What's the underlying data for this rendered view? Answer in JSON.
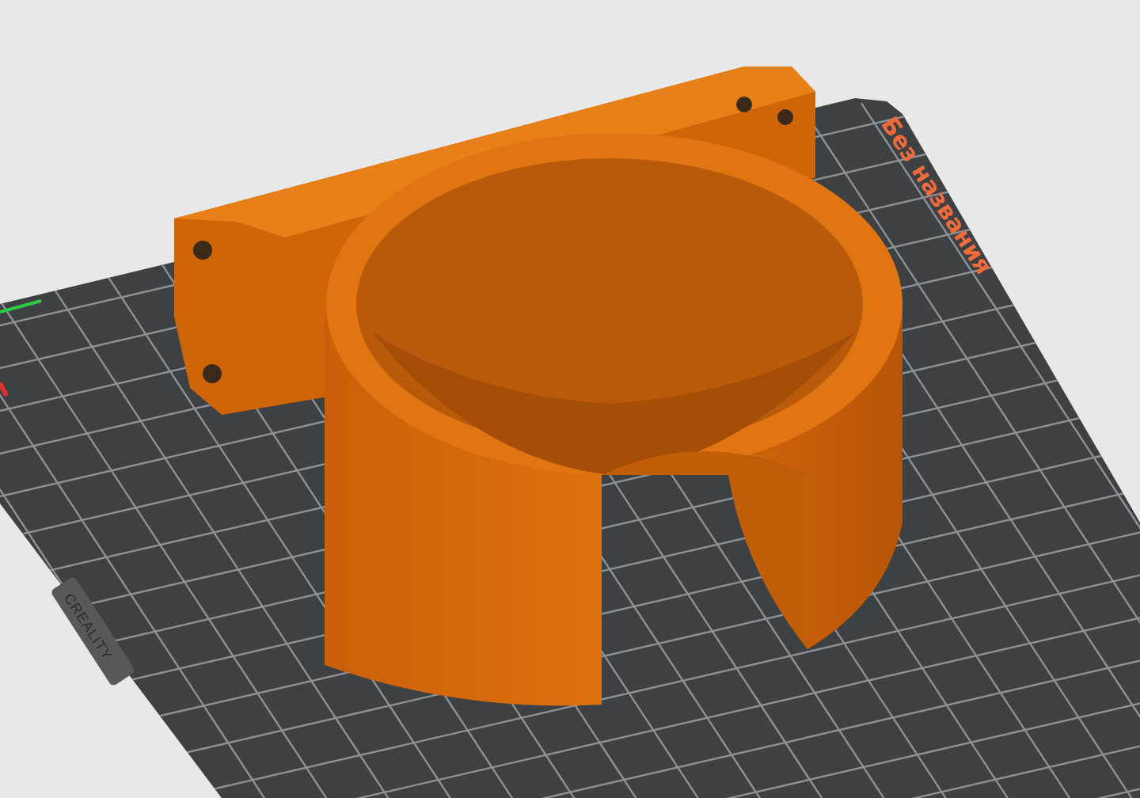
{
  "build_plate": {
    "label": "Без названия",
    "brand": "CREALITY"
  }
}
